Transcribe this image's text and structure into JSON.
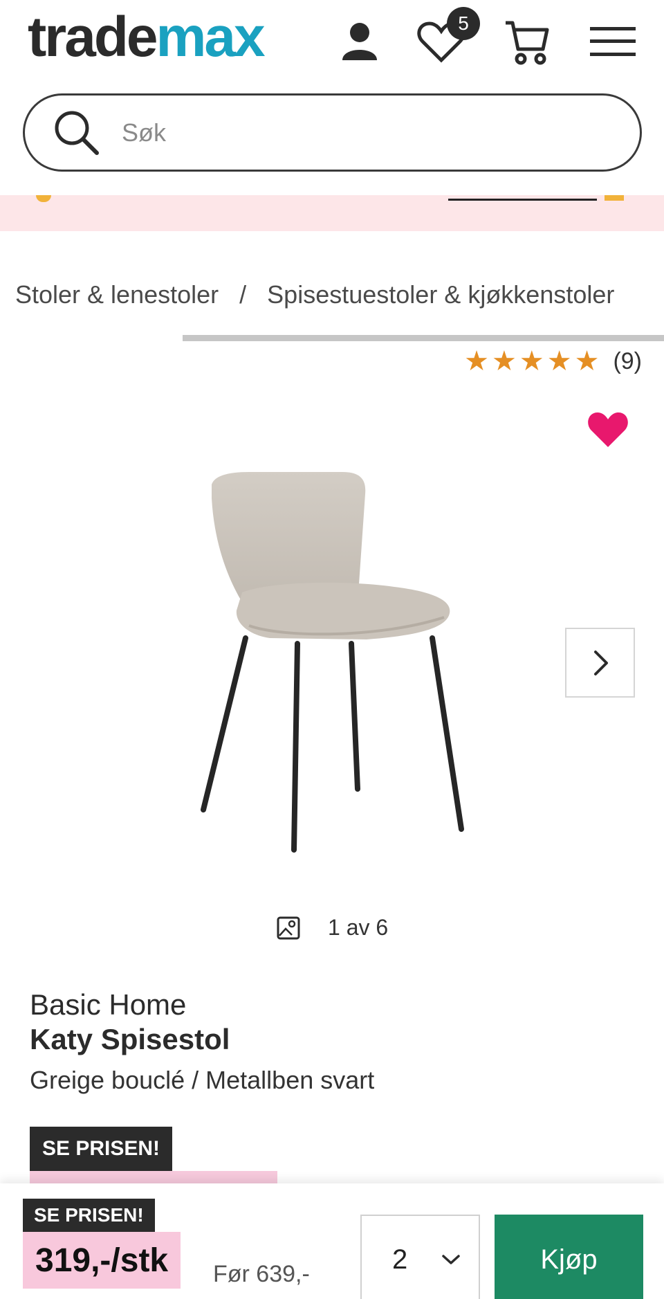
{
  "header": {
    "logo_part1": "trade",
    "logo_part2": "max",
    "wishlist_count": "5"
  },
  "search": {
    "placeholder": "Søk"
  },
  "breadcrumb": {
    "items": [
      "Stoler & lenestoler",
      "Spisestuestoler & kjøkkenstoler"
    ],
    "separator": "/"
  },
  "rating": {
    "stars": 5,
    "count": "(9)"
  },
  "gallery": {
    "counter": "1 av 6"
  },
  "product": {
    "brand": "Basic Home",
    "name": "Katy Spisestol",
    "variant": "Greige bouclé / Metallben svart",
    "tag": "SE PRISEN!"
  },
  "sticky": {
    "tag": "SE PRISEN!",
    "price": "319,-/stk",
    "before": "Før 639,-",
    "quantity": "2",
    "buy_label": "Kjøp"
  },
  "colors": {
    "accent": "#1aa1c0",
    "buy": "#1d8a63",
    "price_bg": "#f8c8dc",
    "star": "#e58f24",
    "heart": "#e8186d"
  }
}
